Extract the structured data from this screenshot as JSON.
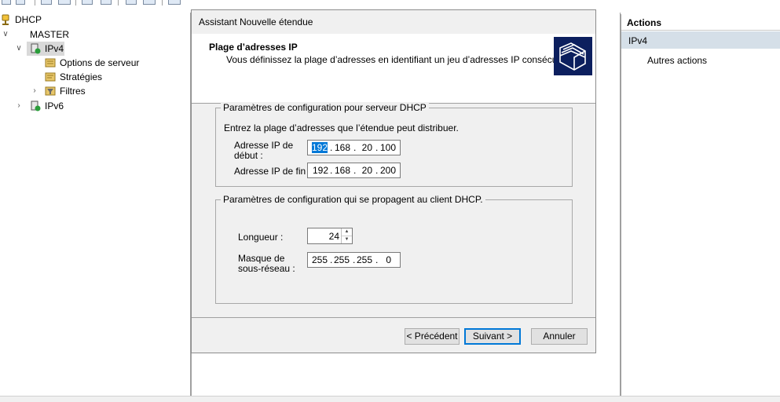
{
  "tree": {
    "items": [
      {
        "label": "DHCP",
        "icon": "dhcp-server-icon"
      },
      {
        "label": "MASTER",
        "expander": "expanded"
      },
      {
        "label": "IPv4",
        "icon": "ipv4-icon",
        "expander": "expanded",
        "selected": true
      },
      {
        "label": "Options de serveur",
        "icon": "server-options-icon"
      },
      {
        "label": "Stratégies",
        "icon": "policies-icon"
      },
      {
        "label": "Filtres",
        "icon": "filters-icon",
        "expander": "collapsed"
      },
      {
        "label": "IPv6",
        "icon": "ipv6-icon",
        "expander": "collapsed"
      }
    ]
  },
  "actions": {
    "title": "Actions",
    "section": "IPv4",
    "more": "Autres actions",
    "more_arrow": "▶"
  },
  "wizard": {
    "window_title": "Assistant Nouvelle étendue",
    "header_title": "Plage d’adresses IP",
    "header_desc": "Vous définissez la plage d’adresses en identifiant un jeu d’adresses IP consécutives.",
    "group1": {
      "legend": "Paramètres de configuration pour serveur DHCP",
      "intro": "Entrez la plage d’adresses que l’étendue peut distribuer.",
      "start_label_line1": "Adresse IP de",
      "start_label_line2": "début :",
      "start_ip": [
        "192",
        "168",
        "20",
        "100"
      ],
      "end_label": "Adresse IP de fin :",
      "end_ip": [
        "192",
        "168",
        "20",
        "200"
      ]
    },
    "group2": {
      "legend": "Paramètres de configuration qui se propagent au client DHCP.",
      "length_label": "Longueur :",
      "length_value": "24",
      "mask_label_line1": "Masque de",
      "mask_label_line2": "sous-réseau :",
      "mask": [
        "255",
        "255",
        "255",
        "0"
      ]
    },
    "buttons": {
      "back": "< Précédent",
      "next": "Suivant >",
      "cancel": "Annuler"
    }
  },
  "colors": {
    "selection": "#0078d7",
    "actions_section_bg": "#d5dfe8",
    "dialog_bg": "#f0f0f0"
  }
}
